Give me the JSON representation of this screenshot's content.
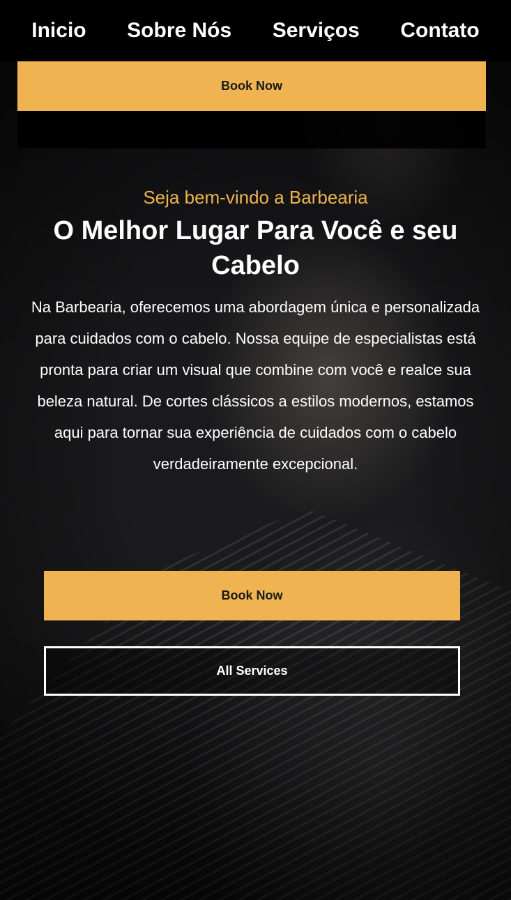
{
  "nav": {
    "links": [
      "Inicio",
      "Sobre Nós",
      "Serviços",
      "Contato"
    ],
    "book_label": "Book Now"
  },
  "hero": {
    "eyebrow": "Seja bem-vindo a Barbearia",
    "headline": "O Melhor Lugar Para Você e seu Cabelo",
    "description": "Na Barbearia, oferecemos uma abordagem única e personalizada para cuidados com o cabelo. Nossa equipe de especialistas está pronta para criar um visual que combine com você e realce sua beleza natural. De cortes clássicos a estilos modernos, estamos aqui para tornar sua experiência de cuidados com o cabelo verdadeiramente excepcional.",
    "book_label": "Book Now",
    "services_label": "All Services"
  },
  "colors": {
    "accent": "#efb451",
    "nav_background": "#000000",
    "text": "#ffffff"
  }
}
